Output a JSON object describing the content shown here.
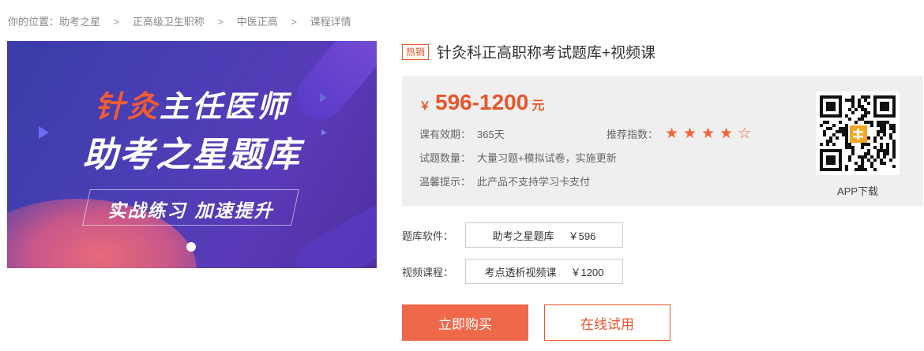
{
  "breadcrumb": {
    "prefix": "你的位置：",
    "items": [
      "助考之星",
      "正高级卫生职称",
      "中医正高",
      "课程详情"
    ],
    "separator": ">"
  },
  "banner": {
    "line1_highlight": "针灸",
    "line1_rest": "主任医师",
    "line2": "助考之星题库",
    "slogan": "实战练习 加速提升"
  },
  "product": {
    "hot_tag": "热销",
    "title": "针灸科正高职称考试题库+视频课",
    "price": {
      "currency": "￥",
      "range": "596-1200",
      "unit": "元"
    },
    "validity": {
      "label": "课有效期：",
      "value": "365天"
    },
    "rating": {
      "label": "推荐指数：",
      "value": 4,
      "max": 5,
      "color": "#f2653c"
    },
    "quantity": {
      "label": "试题数量：",
      "value": "大量习题+模拟试卷，实施更新"
    },
    "notice": {
      "label": "温馨提示：",
      "value": "此产品不支持学习卡支付"
    },
    "app": {
      "label": "APP下载",
      "icon": "qr-code-icon"
    }
  },
  "options": [
    {
      "label": "题库软件：",
      "name": "助考之星题库",
      "price": "￥596"
    },
    {
      "label": "视频课程：",
      "name": "考点透析视频课",
      "price": "￥1200"
    }
  ],
  "actions": {
    "buy": "立即购买",
    "trial": "在线试用"
  },
  "colors": {
    "accent": "#e8552a",
    "buy_button": "#f0684a",
    "price_box_bg": "#efefef",
    "banner_bg": "#4a3fb5"
  }
}
